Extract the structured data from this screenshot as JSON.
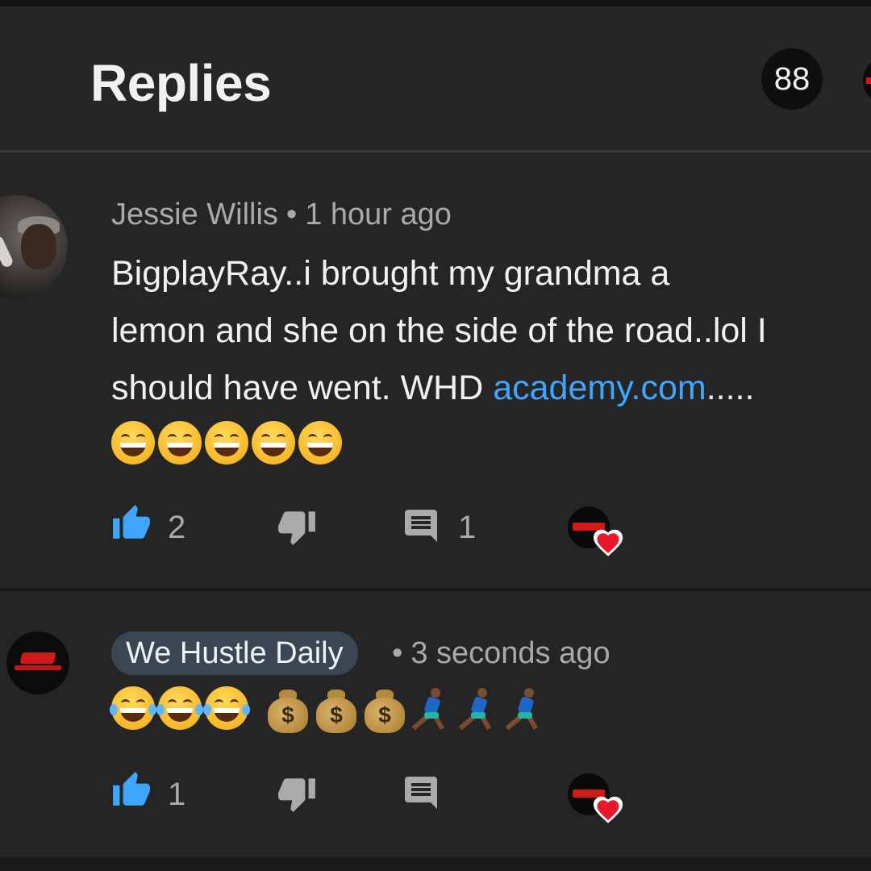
{
  "header": {
    "title": "Replies",
    "count_badge": "88"
  },
  "comments": [
    {
      "author": "Jessie Willis",
      "separator": "•",
      "time": "1 hour ago",
      "text_line1": "BigplayRay..i brought my grandma a",
      "text_line2": "lemon and she on the side of the road..lol I",
      "text_line3_prefix": "should have  went. WHD ",
      "text_link": "academy.com",
      "text_line3_suffix": ".....",
      "emojis": [
        "grinning-face-with-smiling-eyes",
        "grinning-face-with-smiling-eyes",
        "grinning-face-with-smiling-eyes",
        "grinning-face-with-smiling-eyes",
        "grinning-face-with-smiling-eyes"
      ],
      "like_count": "2",
      "reply_count": "1",
      "hearted_by_creator": true
    },
    {
      "author": "We Hustle Daily",
      "separator": "•",
      "time": "3 seconds ago",
      "emojis": [
        "face-with-tears-of-joy",
        "face-with-tears-of-joy",
        "face-with-tears-of-joy",
        "money-bag",
        "money-bag",
        "money-bag",
        "person-running",
        "person-running",
        "person-running"
      ],
      "like_count": "1",
      "reply_count": "",
      "hearted_by_creator": true
    }
  ],
  "icons": {
    "like": "thumbs-up-icon",
    "dislike": "thumbs-down-icon",
    "reply": "comment-icon",
    "heart": "heart-icon"
  },
  "colors": {
    "background": "#1b1b1b",
    "card": "#252525",
    "like_active": "#3ea6ff",
    "link": "#3ea6ff",
    "heart": "#e8182a",
    "author_chip": "#3b4654"
  },
  "emoji_glyphs": {
    "money_sign": "$"
  }
}
